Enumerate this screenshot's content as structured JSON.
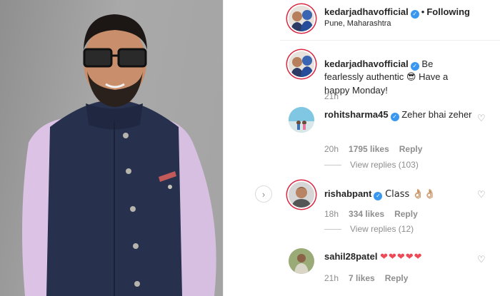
{
  "post": {
    "username": "kedarjadhavofficial",
    "following_label": "Following",
    "location": "Pune, Maharashtra",
    "caption_pre": "Be fearlessly authentic",
    "caption_emoji": "😎",
    "caption_post": "Have a happy Monday!",
    "caption_time": "21h"
  },
  "comments": [
    {
      "username": "rohitsharma45",
      "text": "Zeher bhai zeher",
      "time": "20h",
      "likes": "1795 likes",
      "reply_label": "Reply",
      "view_replies": "View replies (103)"
    },
    {
      "username": "rishabpant",
      "text": "Class 👌🏼👌🏼",
      "time": "18h",
      "likes": "334 likes",
      "reply_label": "Reply",
      "view_replies": "View replies (12)"
    },
    {
      "username": "sahil28patel",
      "text": "❤❤❤❤❤",
      "time": "21h",
      "likes": "7 likes",
      "reply_label": "Reply"
    }
  ],
  "icons": {
    "verified": "verified-badge-icon",
    "heart": "heart-outline-icon",
    "next": "chevron-right-icon"
  },
  "colors": {
    "verified": "#3897f0",
    "story_ring": "#dc2743",
    "muted_text": "#8e8e8e",
    "hearts": "#ed4956"
  }
}
